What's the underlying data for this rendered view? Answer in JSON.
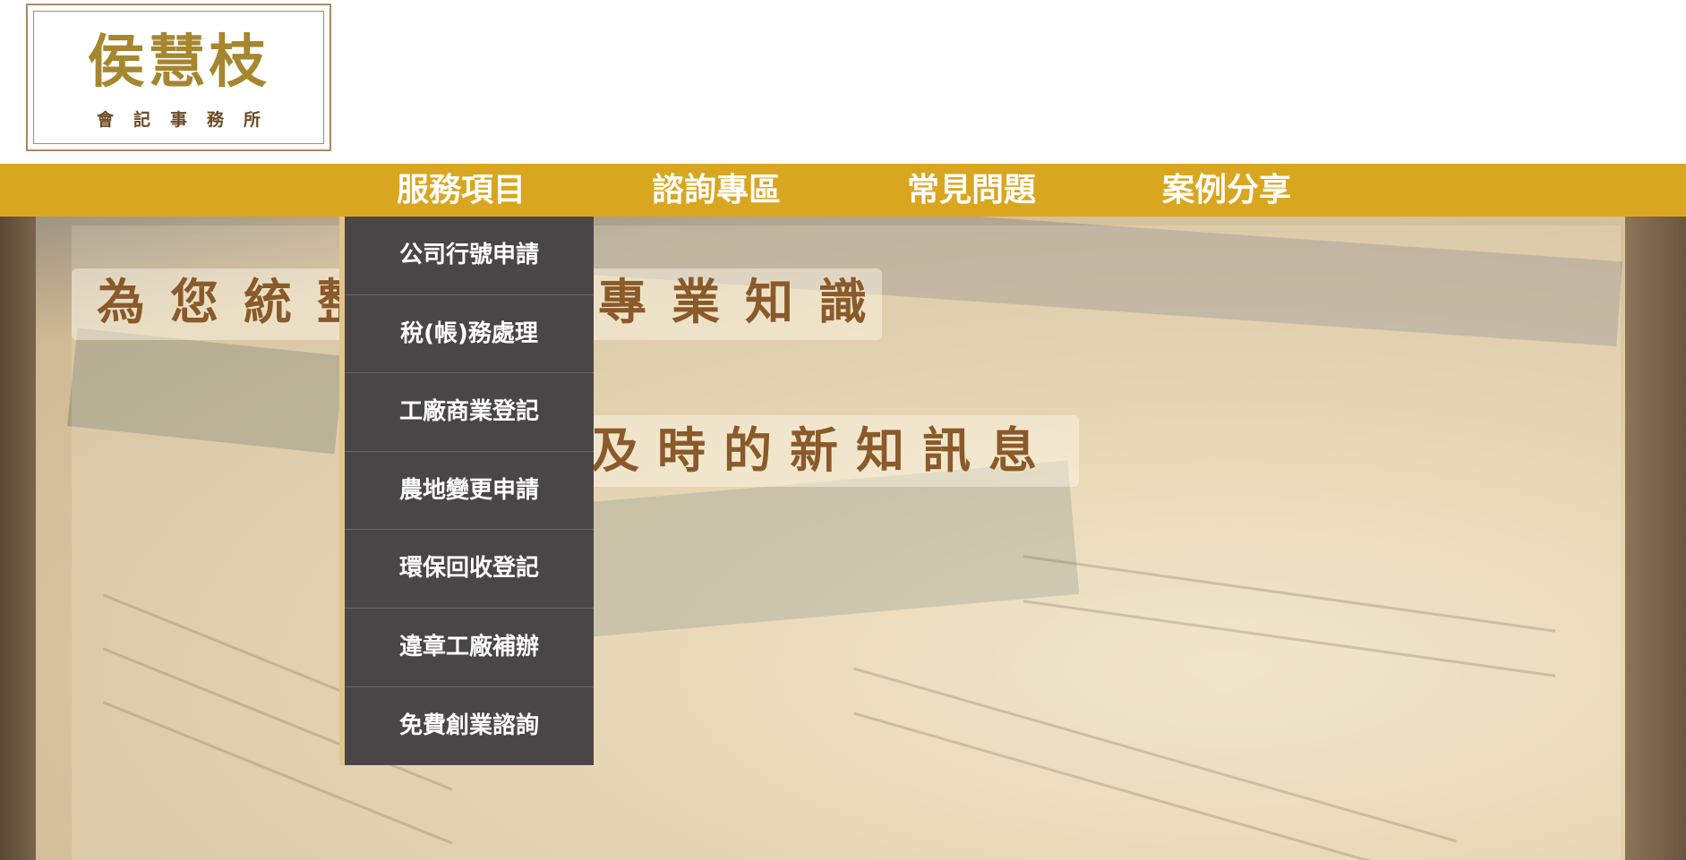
{
  "logo": {
    "name": "侯慧枝",
    "subtitle": "會記事務所"
  },
  "nav": {
    "items": [
      {
        "label": "服務項目"
      },
      {
        "label": "諮詢專區"
      },
      {
        "label": "常見問題"
      },
      {
        "label": "案例分享"
      }
    ]
  },
  "dropdown": {
    "items": [
      {
        "label": "公司行號申請"
      },
      {
        "label": "稅(帳)務處理"
      },
      {
        "label": "工廠商業登記"
      },
      {
        "label": "農地變更申請"
      },
      {
        "label": "環保回收登記"
      },
      {
        "label": "違章工廠補辦"
      },
      {
        "label": "免費創業諮詢"
      }
    ]
  },
  "hero": {
    "headline_1_left": "為您統整",
    "headline_1_right": "專業知識",
    "headline_2_right": "及時的新知訊息"
  },
  "colors": {
    "nav_bar": "#d9a620",
    "dropdown_bg": "#4a4547",
    "logo_gold": "#a6862e",
    "headline_brown": "#8a5a2b"
  }
}
